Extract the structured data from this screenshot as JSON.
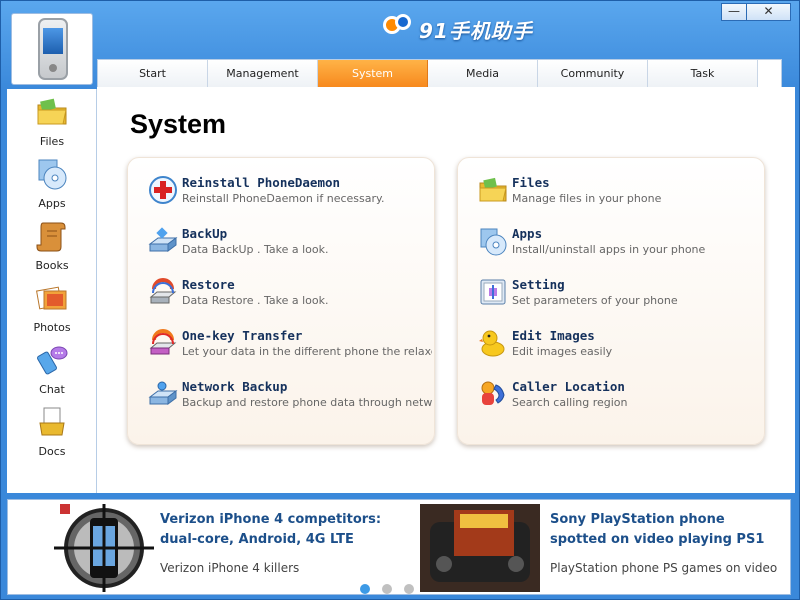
{
  "app": {
    "title": "91手机助手",
    "minimize_label": "—",
    "close_label": "✕"
  },
  "tabs": [
    {
      "label": "Start"
    },
    {
      "label": "Management"
    },
    {
      "label": "System",
      "active": true
    },
    {
      "label": "Media"
    },
    {
      "label": "Community"
    },
    {
      "label": "Task"
    }
  ],
  "sidebar": {
    "items": [
      {
        "label": "Files",
        "icon": "folder-icon"
      },
      {
        "label": "Apps",
        "icon": "apps-disc-icon"
      },
      {
        "label": "Books",
        "icon": "scroll-book-icon"
      },
      {
        "label": "Photos",
        "icon": "photos-icon"
      },
      {
        "label": "Chat",
        "icon": "chat-icon"
      },
      {
        "label": "Docs",
        "icon": "docs-icon"
      }
    ]
  },
  "main": {
    "title": "System",
    "left_panel": [
      {
        "title": "Reinstall PhoneDaemon",
        "desc": "Reinstall PhoneDaemon if necessary.",
        "icon": "medical-cross-icon"
      },
      {
        "title": "BackUp",
        "desc": "Data BackUp . Take a look.",
        "icon": "backup-drive-icon"
      },
      {
        "title": "Restore",
        "desc": "Data Restore . Take a look.",
        "icon": "restore-icon"
      },
      {
        "title": "One-key Transfer",
        "desc": "Let your data in the different phone the relaxe",
        "icon": "transfer-icon"
      },
      {
        "title": "Network Backup",
        "desc": "Backup and restore phone data through netw",
        "icon": "network-backup-icon"
      }
    ],
    "right_panel": [
      {
        "title": "Files",
        "desc": "Manage files in your phone",
        "icon": "folder-icon"
      },
      {
        "title": "Apps",
        "desc": "Install/uninstall apps in your phone",
        "icon": "apps-disc-icon"
      },
      {
        "title": "Setting",
        "desc": "Set parameters of your phone",
        "icon": "setting-icon"
      },
      {
        "title": "Edit Images",
        "desc": "Edit images easily",
        "icon": "duck-icon"
      },
      {
        "title": "Caller Location",
        "desc": "Search calling region",
        "icon": "caller-location-icon"
      }
    ]
  },
  "news": [
    {
      "title": "Verizon iPhone 4 competitors: dual-core, Android, 4G LTE",
      "sub": "Verizon iPhone 4 killers"
    },
    {
      "title": "Sony PlayStation phone spotted on video playing PS1",
      "sub": "PlayStation phone PS games on video"
    }
  ],
  "colors": {
    "accent": "#f7891e",
    "frame": "#3a88da",
    "item_title": "#15315c",
    "news_title": "#1c4f8a"
  }
}
